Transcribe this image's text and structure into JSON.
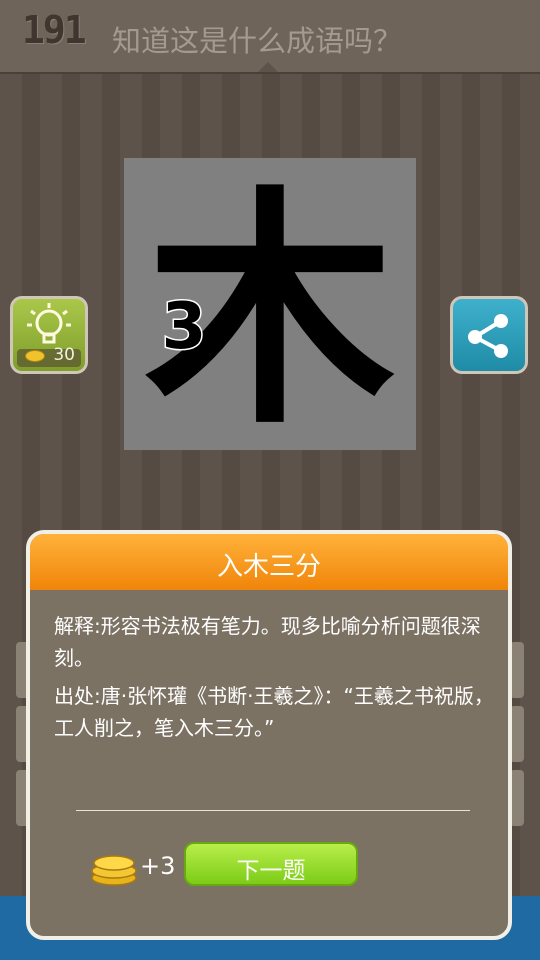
{
  "header": {
    "level": "191",
    "question": "知道这是什么成语吗？"
  },
  "puzzle": {
    "big_char": "木",
    "small_number": "3"
  },
  "hint_button": {
    "cost": "30"
  },
  "modal": {
    "title": "入木三分",
    "explain_label": "解释:",
    "explain_text": "形容书法极有笔力。现多比喻分析问题很深刻。",
    "origin_label": "出处:",
    "origin_text": "唐·张怀瓘《书断·王羲之》：“王羲之书祝版，工人削之，笔入木三分。”",
    "reward": "+3",
    "next_label": "下一题"
  },
  "colors": {
    "header_orange": "#f0850a",
    "next_green": "#8ed41f",
    "hint_green": "#95b53a",
    "share_blue": "#2a9cb8"
  },
  "icons": [
    "lightbulb-icon",
    "share-icon",
    "coin-icon"
  ]
}
